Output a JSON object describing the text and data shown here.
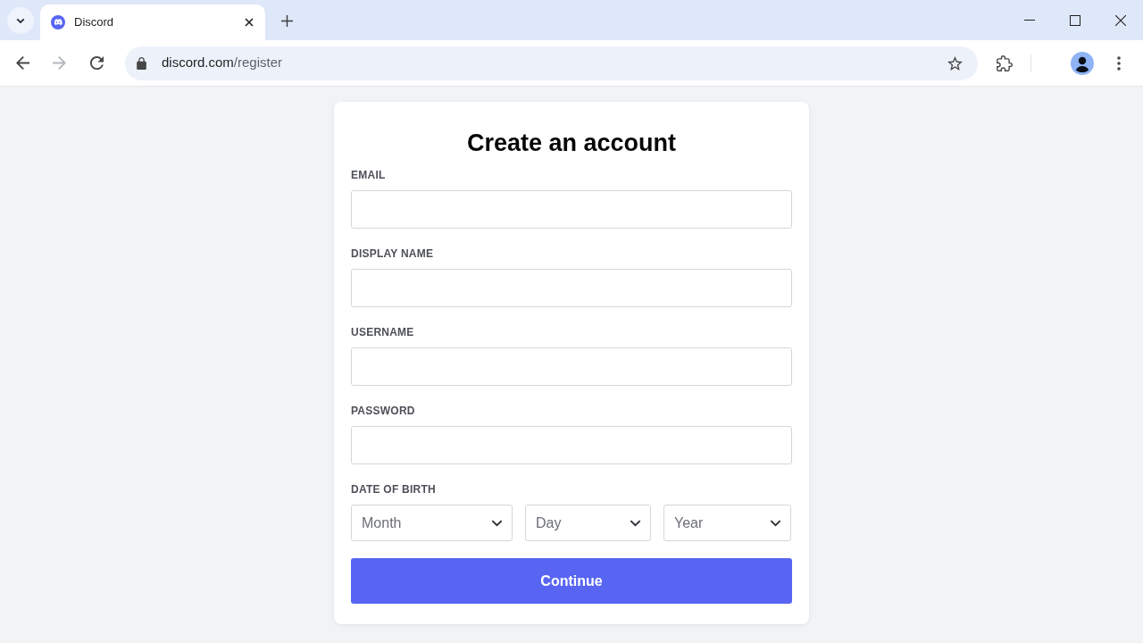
{
  "browser": {
    "tabs": [
      {
        "title": "Discord",
        "selected": true
      }
    ],
    "navigation": {
      "back": {
        "disabled": false
      },
      "forward": {
        "disabled": true
      }
    },
    "address_bar": {
      "host": "discord.com",
      "path": "/register"
    }
  },
  "form": {
    "title": "Create an account",
    "fields": [
      {
        "label": "EMAIL"
      },
      {
        "label": "DISPLAY NAME"
      },
      {
        "label": "USERNAME"
      },
      {
        "label": "PASSWORD"
      }
    ],
    "date_of_birth": {
      "label": "DATE OF BIRTH",
      "dropdowns": [
        {
          "placeholder": "Month"
        },
        {
          "placeholder": "Day"
        },
        {
          "placeholder": "Year"
        }
      ]
    },
    "submit": {
      "label": "Continue"
    }
  }
}
